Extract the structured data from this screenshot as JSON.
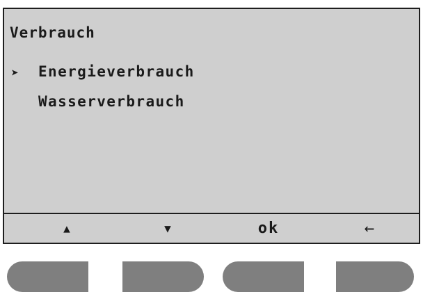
{
  "screen": {
    "title": "Verbrauch",
    "menu_items": [
      {
        "label": "Energieverbrauch",
        "selected": true,
        "cursor": "➤"
      },
      {
        "label": "Wasserverbrauch",
        "selected": false,
        "cursor": ""
      }
    ]
  },
  "softkeys": {
    "up": "▲",
    "down": "▼",
    "ok": "ok",
    "back": "←"
  },
  "colors": {
    "display_background": "#cfcfcf",
    "text": "#1a1a1a",
    "hardware_button": "#7f7f7f"
  }
}
